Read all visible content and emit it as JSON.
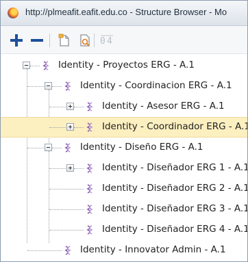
{
  "window": {
    "title": "http://plmeafit.eafit.edu.co - Structure Browser - Mo"
  },
  "toolbar": {
    "buttons": [
      {
        "name": "add",
        "icon": "plus-icon"
      },
      {
        "name": "remove",
        "icon": "minus-icon"
      },
      {
        "name": "new-document",
        "icon": "new-document-icon"
      },
      {
        "name": "preview",
        "icon": "preview-document-icon"
      },
      {
        "name": "compare",
        "icon": "compare-icon"
      }
    ]
  },
  "tree": {
    "nodes": [
      {
        "label": "Identity - Proyectos ERG - A.1",
        "expander": "collapse"
      },
      {
        "label": "Identity - Coordinacion ERG - A.1",
        "expander": "collapse"
      },
      {
        "label": "Identity - Asesor ERG - A.1",
        "expander": "expand"
      },
      {
        "label": "Identity - Coordinador ERG - A.1",
        "expander": "expand",
        "selected": true
      },
      {
        "label": "Identity - Diseño ERG - A.1",
        "expander": "collapse"
      },
      {
        "label": "Identity - Diseñador ERG 1 - A.1",
        "expander": "expand"
      },
      {
        "label": "Identity - Diseñador ERG 2 - A.1",
        "expander": "none"
      },
      {
        "label": "Identity - Diseñador ERG 3 - A.1",
        "expander": "none"
      },
      {
        "label": "Identity - Diseñador ERG 4 - A.1",
        "expander": "none"
      },
      {
        "label": "Identity - Innovator Admin - A.1",
        "expander": "none"
      }
    ]
  },
  "colors": {
    "selected_row": "#fcefc0",
    "toolbar_plus": "#1f4f9c",
    "node_icon": "#8b5fb3"
  }
}
